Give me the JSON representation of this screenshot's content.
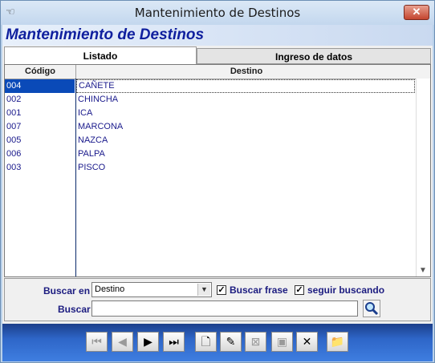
{
  "window": {
    "title": "Mantenimiento de Destinos",
    "close_glyph": "✕",
    "app_icon": "hand-icon"
  },
  "header": {
    "title": "Mantenimiento de Destinos"
  },
  "tabs": [
    {
      "label": "Listado",
      "active": true
    },
    {
      "label": "Ingreso de datos",
      "active": false
    }
  ],
  "grid": {
    "columns": [
      "Código",
      "Destino"
    ],
    "rows": [
      {
        "codigo": "004",
        "destino": "CAÑETE",
        "selected": true
      },
      {
        "codigo": "002",
        "destino": "CHINCHA"
      },
      {
        "codigo": "001",
        "destino": "ICA"
      },
      {
        "codigo": "007",
        "destino": "MARCONA"
      },
      {
        "codigo": "005",
        "destino": "NAZCA"
      },
      {
        "codigo": "006",
        "destino": "PALPA"
      },
      {
        "codigo": "003",
        "destino": "PISCO"
      }
    ]
  },
  "search": {
    "buscar_en_label": "Buscar en",
    "buscar_en_value": "Destino",
    "buscar_frase_label": "Buscar frase",
    "buscar_frase_checked": true,
    "seguir_buscando_label": "seguir buscando",
    "seguir_buscando_checked": true,
    "buscar_label": "Buscar",
    "buscar_value": ""
  },
  "colors": {
    "header_text": "#0f1f9e",
    "selection": "#0a4ab8",
    "toolbar": "#2e66c8"
  },
  "toolbar": [
    {
      "name": "first-record",
      "icon": "first-icon"
    },
    {
      "name": "previous-record",
      "icon": "previous-icon"
    },
    {
      "name": "next-record",
      "icon": "next-icon"
    },
    {
      "name": "last-record",
      "icon": "last-icon"
    },
    {
      "name": "new-record",
      "icon": "new-document-icon"
    },
    {
      "name": "edit-record",
      "icon": "edit-icon"
    },
    {
      "name": "cancel-edit",
      "icon": "cancel-edit-icon"
    },
    {
      "name": "save-record",
      "icon": "save-icon"
    },
    {
      "name": "delete-record",
      "icon": "delete-icon"
    },
    {
      "name": "exit",
      "icon": "exit-folder-icon"
    }
  ]
}
